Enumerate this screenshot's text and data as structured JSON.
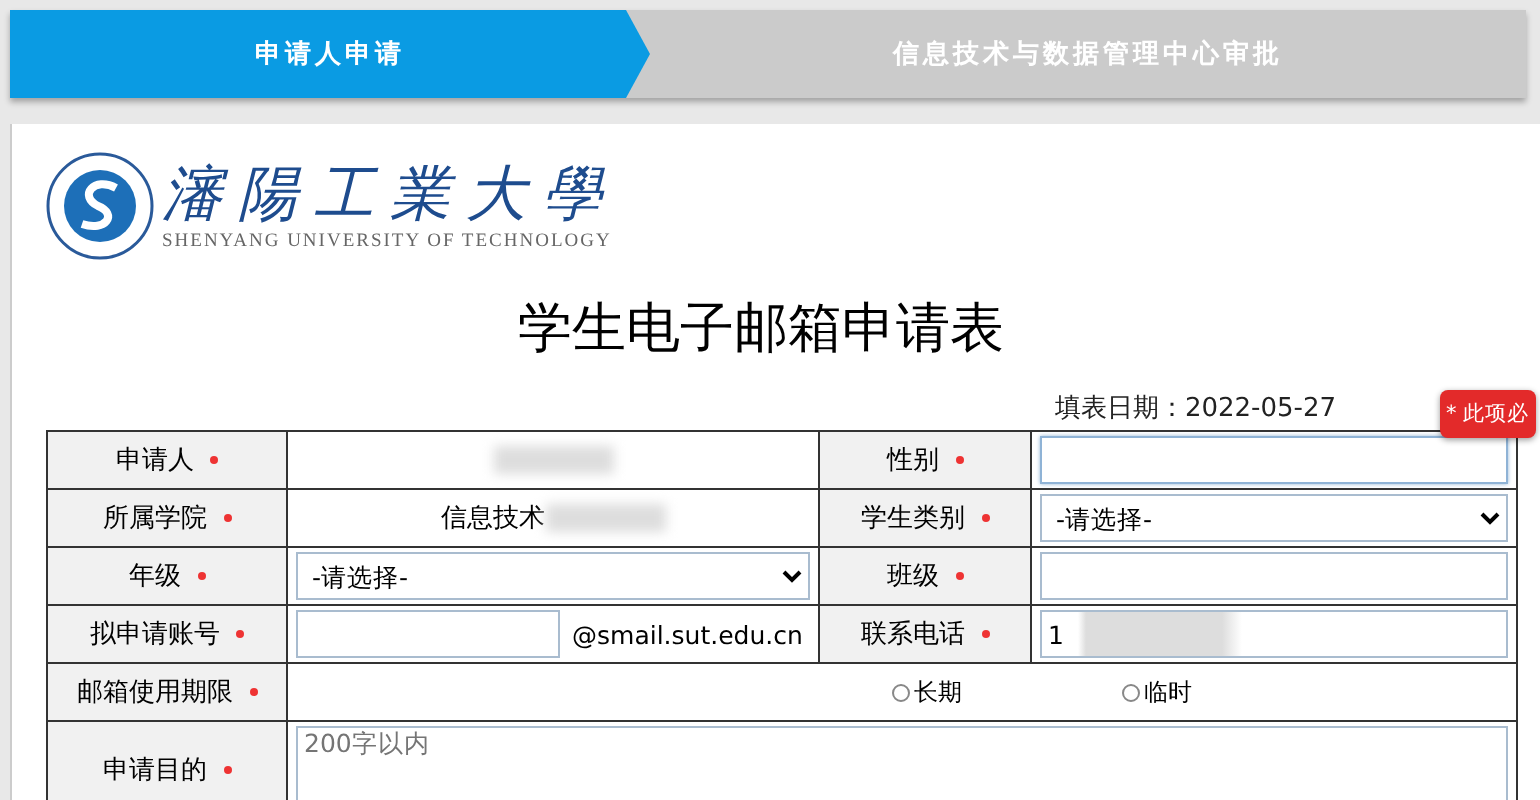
{
  "steps": [
    {
      "label": "申请人申请",
      "selected": true
    },
    {
      "label": "信息技术与数据管理中心审批",
      "selected": false
    }
  ],
  "logo": {
    "name": "瀋陽工業大學",
    "subtitle": "SHENYANG UNIVERSITY OF TECHNOLOGY"
  },
  "title": "学生电子邮箱申请表",
  "date": "填表日期：2022-05-27",
  "tooltip": "* 此项必",
  "rows": [
    {
      "fields": [
        {
          "label": "申请人",
          "required": true,
          "kind": "text",
          "blurred": true
        },
        {
          "label": "性别",
          "required": true,
          "kind": "input",
          "focused": true
        }
      ]
    },
    {
      "fields": [
        {
          "label": "所属学院",
          "required": true,
          "kind": "text",
          "value": "信息技术",
          "blurred": true
        },
        {
          "label": "学生类别",
          "required": true,
          "kind": "select",
          "value": "-请选择-"
        }
      ]
    },
    {
      "fields": [
        {
          "label": "年级",
          "required": true,
          "kind": "select",
          "value": "-请选择-"
        },
        {
          "label": "班级",
          "required": true,
          "kind": "input",
          "focused": false
        }
      ]
    },
    {
      "fields": [
        {
          "label": "拟申请账号",
          "required": true,
          "kind": "email",
          "suffix": "@smail.sut.edu.cn"
        },
        {
          "label": "联系电话",
          "required": true,
          "kind": "input",
          "value": "1",
          "blurred": true,
          "focused": false
        }
      ]
    },
    {
      "fields": [
        {
          "label": "邮箱使用期限",
          "required": true,
          "kind": "radio",
          "options": [
            {
              "label": "长期",
              "selected": false
            },
            {
              "label": "临时",
              "selected": false
            }
          ]
        }
      ]
    },
    {
      "fields": [
        {
          "label": "申请目的",
          "required": true,
          "kind": "textarea",
          "placeholder": "200字以内"
        }
      ]
    }
  ]
}
